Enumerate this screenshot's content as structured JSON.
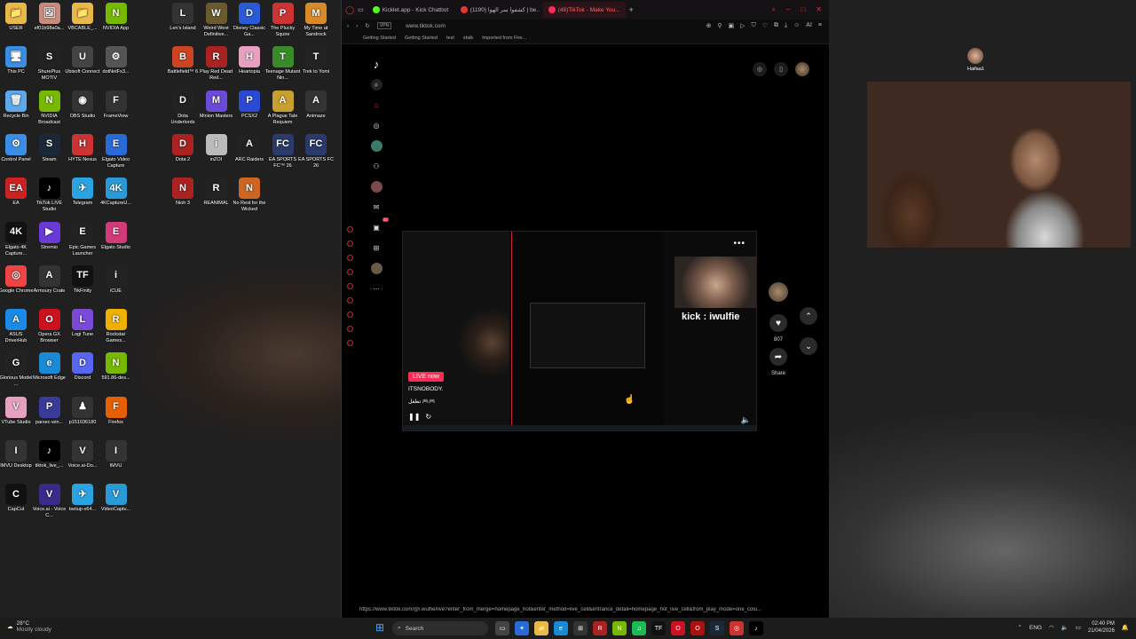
{
  "desktop": {
    "icons": [
      {
        "label": "USER",
        "color": "#e8b84a",
        "glyph": "📁"
      },
      {
        "label": "ef01b98a0a...",
        "color": "#c98b7c",
        "glyph": "🖼"
      },
      {
        "label": "VBCABLE_...",
        "color": "#e8b84a",
        "glyph": "📁"
      },
      {
        "label": "NVIDIA App",
        "color": "#76b900",
        "glyph": "N"
      },
      {
        "label": "This PC",
        "color": "#3a8ee6",
        "glyph": "🖥"
      },
      {
        "label": "ShurePlus MOTIV",
        "color": "#222",
        "glyph": "S"
      },
      {
        "label": "Ubisoft Connect",
        "color": "#444",
        "glyph": "U"
      },
      {
        "label": "dotNetFx3...",
        "color": "#555",
        "glyph": "⚙"
      },
      {
        "label": "Recycle Bin",
        "color": "#5ea7e8",
        "glyph": "🗑"
      },
      {
        "label": "NVIDIA Broadcast",
        "color": "#76b900",
        "glyph": "N"
      },
      {
        "label": "OBS Studio",
        "color": "#333",
        "glyph": "◉"
      },
      {
        "label": "FrameView",
        "color": "#333",
        "glyph": "F"
      },
      {
        "label": "Control Panel",
        "color": "#3a8ee6",
        "glyph": "⚙"
      },
      {
        "label": "Steam",
        "color": "#1b2838",
        "glyph": "S"
      },
      {
        "label": "HYTE Nexus",
        "color": "#c33",
        "glyph": "H"
      },
      {
        "label": "Elgato Video Capture",
        "color": "#2a6ad6",
        "glyph": "E"
      },
      {
        "label": "EA",
        "color": "#c22",
        "glyph": "EA"
      },
      {
        "label": "TikTok LIVE Studio",
        "color": "#000",
        "glyph": "♪"
      },
      {
        "label": "Telegram",
        "color": "#2aa3e0",
        "glyph": "✈"
      },
      {
        "label": "4KCaptureU...",
        "color": "#2a9ad6",
        "glyph": "4K"
      },
      {
        "label": "Elgato 4K Capture...",
        "color": "#111",
        "glyph": "4K"
      },
      {
        "label": "Stremio",
        "color": "#6a3ad6",
        "glyph": "▶"
      },
      {
        "label": "Epic Games Launcher",
        "color": "#222",
        "glyph": "E"
      },
      {
        "label": "Elgato Studio",
        "color": "#d23a7a",
        "glyph": "E"
      },
      {
        "label": "Google Chrome",
        "color": "#e44",
        "glyph": "◎"
      },
      {
        "label": "Armoury Crate",
        "color": "#333",
        "glyph": "A"
      },
      {
        "label": "TikFinity",
        "color": "#111",
        "glyph": "TF"
      },
      {
        "label": "iCUE",
        "color": "#222",
        "glyph": "i"
      },
      {
        "label": "ASUS DriverHub",
        "color": "#1a8ae6",
        "glyph": "A"
      },
      {
        "label": "Opera GX Browser",
        "color": "#c12",
        "glyph": "O"
      },
      {
        "label": "Logi Tune",
        "color": "#7a4ad6",
        "glyph": "L"
      },
      {
        "label": "Rockstar Games...",
        "color": "#f0b000",
        "glyph": "R"
      },
      {
        "label": "Glorious Model ...",
        "color": "#222",
        "glyph": "G"
      },
      {
        "label": "Microsoft Edge",
        "color": "#1a8ad6",
        "glyph": "e"
      },
      {
        "label": "Discord",
        "color": "#5865f2",
        "glyph": "D"
      },
      {
        "label": "591.86-des...",
        "color": "#76b900",
        "glyph": "N"
      },
      {
        "label": "VTube Studio",
        "color": "#e8a0c0",
        "glyph": "V"
      },
      {
        "label": "parsec-win...",
        "color": "#3a3a9a",
        "glyph": "P"
      },
      {
        "label": "p151036180",
        "color": "#333",
        "glyph": "♟"
      },
      {
        "label": "Firefox",
        "color": "#e66000",
        "glyph": "F"
      },
      {
        "label": "IMVU Desktop",
        "color": "#333",
        "glyph": "I"
      },
      {
        "label": "tiktok_live_...",
        "color": "#000",
        "glyph": "♪"
      },
      {
        "label": "Voice.ai-Do...",
        "color": "#333",
        "glyph": "V"
      },
      {
        "label": "IMVU",
        "color": "#333",
        "glyph": "I"
      },
      {
        "label": "CapCut",
        "color": "#111",
        "glyph": "C"
      },
      {
        "label": "Voice.ai - Voice C...",
        "color": "#3a2a8a",
        "glyph": "V"
      },
      {
        "label": "tsetup-x64...",
        "color": "#2aa3e0",
        "glyph": "✈"
      },
      {
        "label": "VideoCaptu...",
        "color": "#2a9ad6",
        "glyph": "V"
      }
    ],
    "icons2": [
      {
        "label": "Len's Island",
        "color": "#333",
        "glyph": "L"
      },
      {
        "label": "Weird West Definitive...",
        "color": "#6a5a30",
        "glyph": "W"
      },
      {
        "label": "Disney Classic Ga...",
        "color": "#2a5ad6",
        "glyph": "D"
      },
      {
        "label": "The Plucky Squire",
        "color": "#c33",
        "glyph": "P"
      },
      {
        "label": "My Time at Sandrock",
        "color": "#d68a2a",
        "glyph": "M"
      },
      {
        "label": "Battlefield™ 6",
        "color": "#c42",
        "glyph": "B"
      },
      {
        "label": "Play Red Dead Red...",
        "color": "#a22",
        "glyph": "R"
      },
      {
        "label": "Heartopia",
        "color": "#e8a0c0",
        "glyph": "H"
      },
      {
        "label": "Teenage Mutant Nin...",
        "color": "#3a8a2a",
        "glyph": "T"
      },
      {
        "label": "Trek to Yomi",
        "color": "#222",
        "glyph": "T"
      },
      {
        "label": "Dota Underlords",
        "color": "#222",
        "glyph": "D"
      },
      {
        "label": "Minion Masters",
        "color": "#6a4ad6",
        "glyph": "M"
      },
      {
        "label": "PCSX2",
        "color": "#2a4ad6",
        "glyph": "P"
      },
      {
        "label": "A Plague Tale Requiem",
        "color": "#c8a030",
        "glyph": "A"
      },
      {
        "label": "Animaze",
        "color": "#333",
        "glyph": "A"
      },
      {
        "label": "Dota 2",
        "color": "#a22",
        "glyph": "D"
      },
      {
        "label": "inZOI",
        "color": "#bbb",
        "glyph": "i"
      },
      {
        "label": "ARC Raiders",
        "color": "#222",
        "glyph": "A"
      },
      {
        "label": "EA SPORTS FC™ 26",
        "color": "#2a3a6a",
        "glyph": "FC"
      },
      {
        "label": "EA SPORTS FC 26",
        "color": "#2a3a6a",
        "glyph": "FC"
      },
      {
        "label": "Nioh 3",
        "color": "#a22",
        "glyph": "N"
      },
      {
        "label": "REANIMAL",
        "color": "#222",
        "glyph": "R"
      },
      {
        "label": "No Rest for the Wicked",
        "color": "#c62",
        "glyph": "N"
      }
    ]
  },
  "browser": {
    "tabs": [
      {
        "label": "Kicklet.app - Kick Chatbot",
        "color": "#53fc18",
        "active": false
      },
      {
        "label": "(1190) كشفوا سر الهوا | be...",
        "color": "#e33",
        "active": false
      },
      {
        "label": "(48)TikTok - Make You...",
        "color": "#fe2c55",
        "active": true
      }
    ],
    "new_tab": "+",
    "url": "www.tiktok.com",
    "vpn": "VPN",
    "ai_label": "AI",
    "bookmarks": [
      "Getting Started",
      "Getting Started",
      "test",
      "stalk",
      "Imported from Fire..."
    ],
    "status_link": "https://www.tiktok.com/@i.wulfie/live?enter_from_merge=homepage_hot&enter_method=live_cell&entrance_detail=homepage_hot_live_cell&from_play_mode=one_colu..."
  },
  "tiktok": {
    "badges": {
      "inbox": "20",
      "activity": "20"
    },
    "live": {
      "badge": "LIVE now",
      "username": "ITSNOBODY.",
      "description": "تطفل 🎮🎮",
      "handle_overlay": "kick : iwulfie"
    },
    "actions": {
      "likes": "807",
      "share": "Share"
    }
  },
  "webcam": {
    "streamer_name": "Haifaa1"
  },
  "taskbar": {
    "weather_temp": "28°C",
    "weather_desc": "Mostly cloudy",
    "search_placeholder": "Search",
    "language": "ENG",
    "time": "02:40 PM",
    "date": "21/04/2026"
  }
}
